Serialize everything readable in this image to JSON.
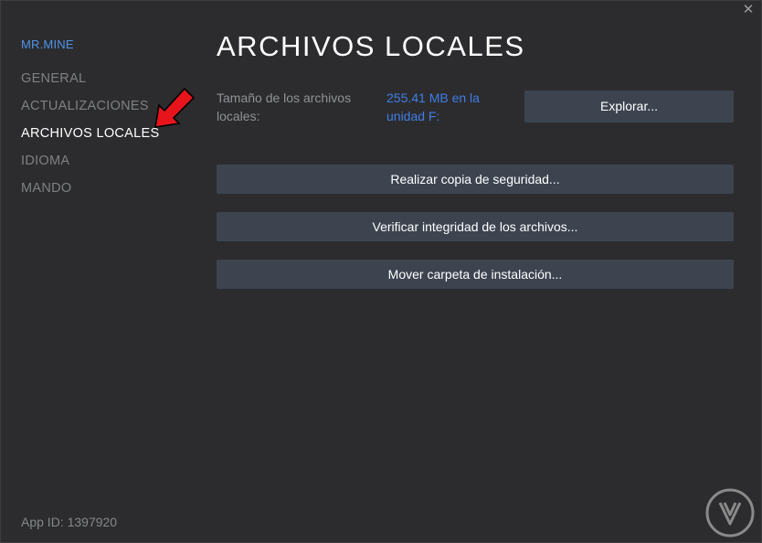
{
  "window": {
    "close_glyph": "✕"
  },
  "sidebar": {
    "game_name": "MR.MINE",
    "items": [
      {
        "label": "GENERAL",
        "active": false
      },
      {
        "label": "ACTUALIZACIONES",
        "active": false
      },
      {
        "label": "ARCHIVOS LOCALES",
        "active": true
      },
      {
        "label": "IDIOMA",
        "active": false
      },
      {
        "label": "MANDO",
        "active": false
      }
    ],
    "app_id": "App ID: 1397920"
  },
  "main": {
    "title": "ARCHIVOS LOCALES",
    "size_label": "Tamaño de los archivos locales:",
    "size_value": "255.41 MB en la unidad F:",
    "explore_button": "Explorar...",
    "backup_button": "Realizar copia de seguridad...",
    "verify_button": "Verificar integridad de los archivos...",
    "move_button": "Mover carpeta de instalación..."
  },
  "colors": {
    "background": "#2c2c2e",
    "accent_blue": "#4f93e8",
    "button_bg": "#3d4450",
    "arrow_red": "#e8141b"
  },
  "icons": {
    "close": "close-icon",
    "annotation": "red-arrow-icon",
    "watermark": "watermark-logo"
  }
}
